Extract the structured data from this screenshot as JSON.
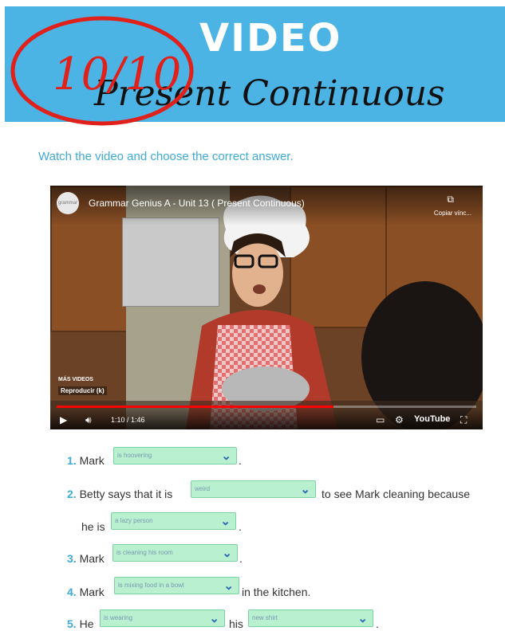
{
  "header": {
    "title_main": "VIDEO",
    "title_sub": "Present Continuous",
    "grade": "10/10",
    "bg_color": "#4cb4e5"
  },
  "instruction": "Watch the video and choose the correct answer.",
  "video": {
    "channel_avatar_text": "grammar",
    "title": "Grammar Genius A - Unit 13 ( Present Continuous)",
    "copy_label": "Copiar vínc...",
    "more_videos": "MÁS VIDEOS",
    "play_label": "Reproducir (k)",
    "time": "1:10 / 1:46",
    "progress": 0.66,
    "youtube_label": "YouTube"
  },
  "questions": [
    {
      "num": "1.",
      "pre": "Mark",
      "answer": "is hoovering",
      "post": "."
    },
    {
      "num": "2.",
      "pre": "Betty says that it is",
      "answer": "weird",
      "post": "to see Mark cleaning because"
    },
    {
      "cont": "he is",
      "answer": "a lazy person",
      "post": "."
    },
    {
      "num": "3.",
      "pre": "Mark",
      "answer": "is cleaning his room",
      "post": "."
    },
    {
      "num": "4.",
      "pre": "Mark",
      "answer": "is mixing food in a bowl",
      "post": "in the kitchen."
    },
    {
      "num": "5.",
      "pre": "He",
      "answer": "is wearing",
      "mid": "his",
      "answer2": "new shirt",
      "post": "."
    }
  ],
  "colors": {
    "accent": "#3eaad6",
    "dropdown": "#b8f0d0",
    "grade_red": "#e0201a"
  }
}
